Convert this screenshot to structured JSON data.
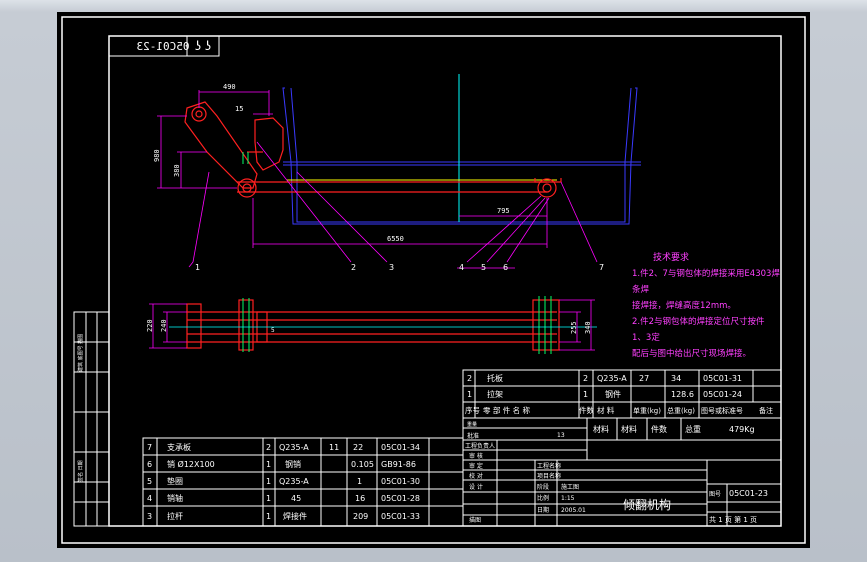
{
  "drawing": {
    "code_mirrored": "05C01-23",
    "title": "倾翻机构",
    "tech_title": "技术要求",
    "tech_lines": [
      "1.件2、7与钢包体的焊接采用E4303焊",
      "  条焊",
      "  接焊接，焊缝高度12mm。",
      "2.件2与钢包体的焊接定位尺寸按件",
      "  1、3定",
      "  配后与图中给出尺寸现场焊接。"
    ],
    "dimensions": {
      "d490": "490",
      "d15": "15",
      "d980": "980",
      "d380": "380",
      "d795": "795",
      "d6550": "6550",
      "d220": "220",
      "d240": "240",
      "d255": "255",
      "d340": "340",
      "d5": "5"
    },
    "callouts": [
      "1",
      "2",
      "3",
      "4",
      "5",
      "6",
      "7"
    ],
    "left_strip": "建筑 底图号 描图",
    "left_strip2": "签名 日期"
  },
  "bom_upper": {
    "rows": [
      [
        "2",
        "托板",
        "2",
        "Q235-A",
        "27",
        "34",
        "05C01-31"
      ],
      [
        "1",
        "拉架",
        "1",
        "钢件",
        "",
        "128.6",
        "05C01-24"
      ]
    ],
    "header": [
      "序号",
      "零 部 件 名 称",
      "件数",
      "材 料",
      "单重(kg)",
      "总重(kg)",
      "图号或标准号",
      "备注"
    ]
  },
  "bom_lower": {
    "rows": [
      [
        "7",
        "支承板",
        "2",
        "Q235-A",
        "11",
        "22",
        "05C01-34"
      ],
      [
        "6",
        "销 Ø12X100",
        "1",
        "钢销",
        "",
        "0.105",
        "GB91-86"
      ],
      [
        "5",
        "垫圈",
        "1",
        "Q235-A",
        "",
        "1",
        "05C01-30"
      ],
      [
        "4",
        "销轴",
        "1",
        "45",
        "",
        "16",
        "05C01-28"
      ],
      [
        "3",
        "拉杆",
        "1",
        "焊接件",
        "",
        "209",
        "05C01-33"
      ]
    ]
  },
  "title_block": {
    "row_labels": [
      "批准",
      "工程负责人",
      "审 核",
      "审 定",
      "校 对",
      "设 计",
      "描图"
    ],
    "mid_labels": [
      "工程名称",
      "项目名称",
      "阶段",
      "比例",
      "日期"
    ],
    "mid_values": [
      "",
      "",
      "施工图",
      "1:15",
      "2005.01"
    ],
    "weight_label": "总重",
    "weight_value": "479Kg",
    "material_label": "材料",
    "qty_label": "件数",
    "drawing_no_label": "图号",
    "drawing_no": "05C01-23",
    "sheet_label": "共 1 页 第 1 页",
    "misc": [
      "重量",
      "13",
      "材料"
    ]
  },
  "colors": {
    "background": "#000000",
    "frame": "#ffffff",
    "part_red": "#ff2020",
    "vessel_blue": "#3a3aff",
    "magenta": "#ff00ff",
    "cyan": "#00ffff",
    "yellow": "#ffff00",
    "green": "#00ff66",
    "tech_text": "#ff40ff"
  }
}
